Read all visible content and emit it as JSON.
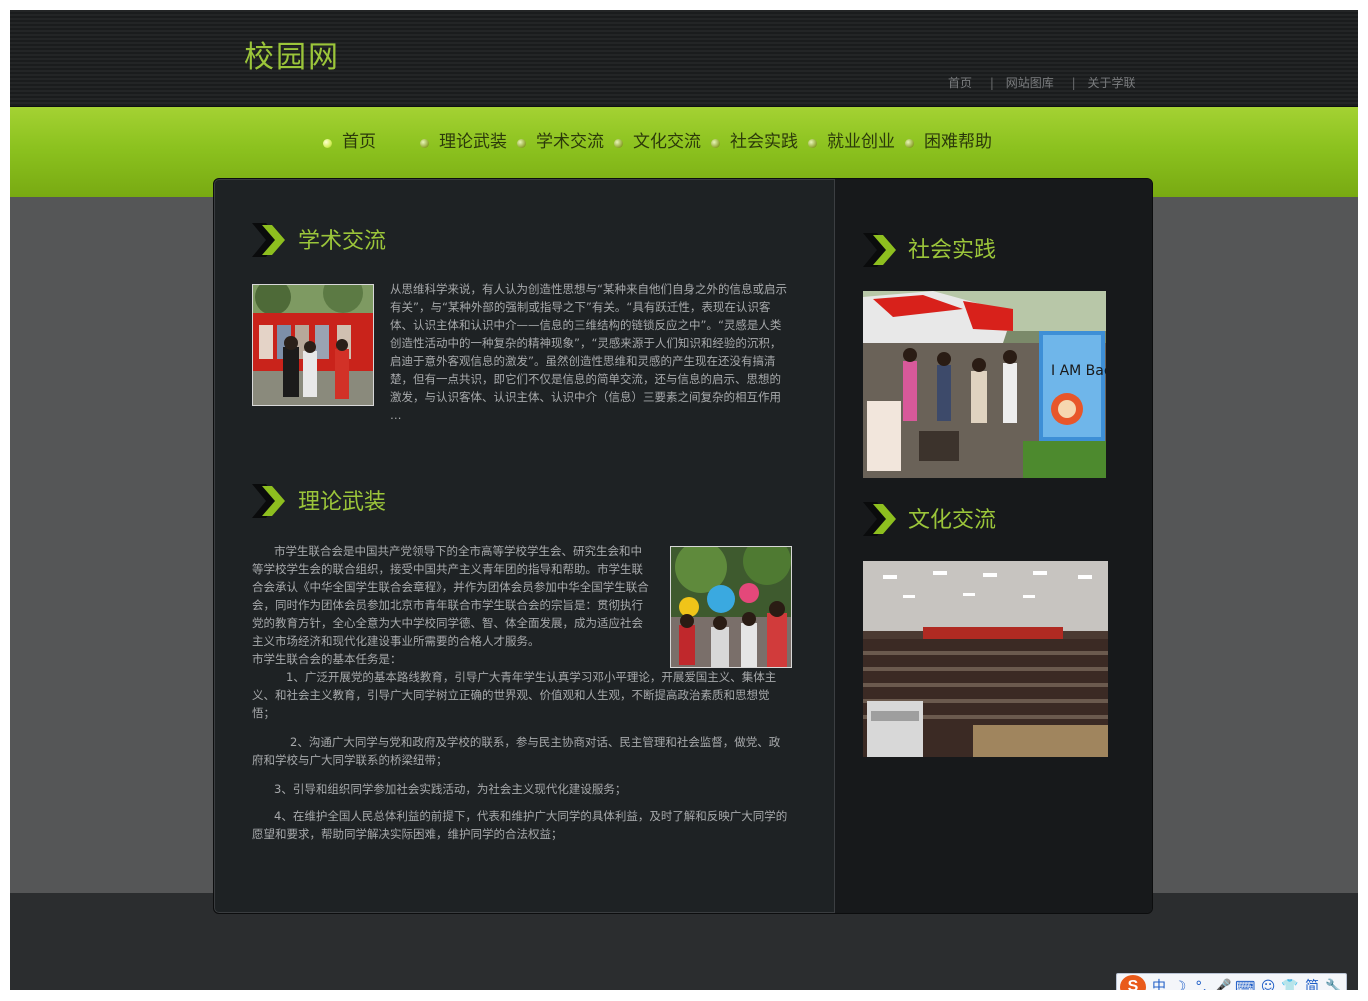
{
  "site": {
    "title": "校园网",
    "top_links": [
      "首页",
      "网站图库",
      "关于学联"
    ],
    "top_sep": "|"
  },
  "nav": {
    "items": [
      "首页",
      "理论武装",
      "学术交流",
      "文化交流",
      "社会实践",
      "就业创业",
      "困难帮助"
    ]
  },
  "main": {
    "section1": {
      "heading": "学术交流",
      "text": "从思维科学来说，有人认为创造性思想与“某种来自他们自身之外的信息或启示有关”，与“某种外部的强制或指导之下”有关。“具有跃迁性，表现在认识客体、认识主体和认识中介——信息的三维结构的链锁反应之中”。“灵感是人类创造性活动中的一种复杂的精神现象”，“灵感来源于人们知识和经验的沉积，启迪于意外客观信息的激发”。虽然创造性思维和灵感的产生现在还没有搞清楚，但有一点共识，即它们不仅是信息的简单交流，还与信息的启示、思想的激发，与认识客体、认识主体、认识中介（信息）三要素之间复杂的相互作用 …"
    },
    "section2": {
      "heading": "理论武装",
      "intro": "市学生联合会是中国共产党领导下的全市高等学校学生会、研究生会和中等学校学生会的联合组织，接受中国共产主义青年团的指导和帮助。市学生联合会承认《中华全国学生联合会章程》，并作为团体会员参加中华全国学生联合会，同时作为团体会员参加北京市青年联合市学生联合会的宗旨是：贯彻执行党的教育方针，全心全意为大中学校同学德、智、体全面发展，成为适应社会主义市场经济和现代化建设事业所需要的合格人才服务。",
      "tasks_label": "市学生联合会的基本任务是：",
      "tasks": [
        "1、广泛开展党的基本路线教育，引导广大青年学生认真学习邓小平理论，开展爱国主义、集体主义、和社会主义教育，引导广大同学树立正确的世界观、价值观和人生观，不断提高政治素质和思想觉悟；",
        "2、沟通广大同学与党和政府及学校的联系，参与民主协商对话、民主管理和社会监督，做党、政府和学校与广大同学联系的桥梁纽带；",
        "3、引导和组织同学参加社会实践活动，为社会主义现代化建设服务；",
        "4、在维护全国人民总体利益的前提下，代表和维护广大同学的具体利益，及时了解和反映广大同学的愿望和要求，帮助同学解决实际困难，维护同学的合法权益；"
      ]
    }
  },
  "sidebar": {
    "section1": {
      "heading": "社会实践"
    },
    "section2": {
      "heading": "文化交流"
    }
  },
  "photos": {
    "p2_sign": "I AM Back"
  },
  "ime": {
    "logo": "S",
    "buttons": [
      "中",
      "☽",
      "°,",
      "🎤",
      "⌨",
      "☺",
      "👕",
      "简",
      "🔧"
    ]
  },
  "colors": {
    "accent": "#9bc53a",
    "nav_green": "#8cc21f",
    "panel": "#1e2224",
    "text": "#a7a9ab"
  }
}
